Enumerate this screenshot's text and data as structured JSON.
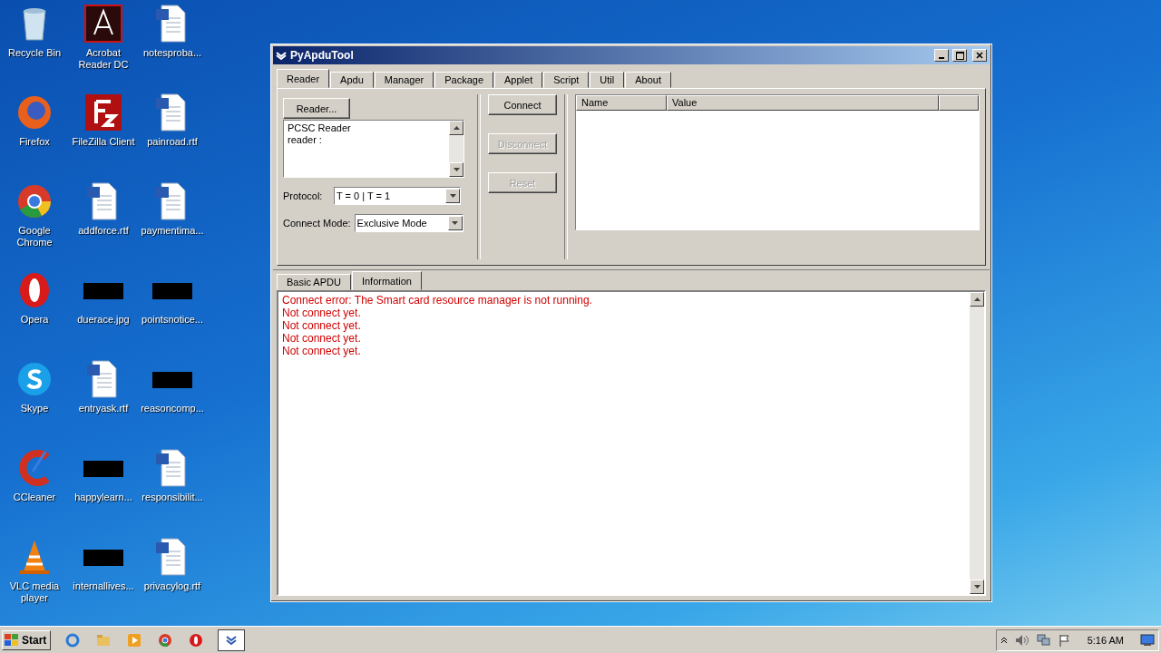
{
  "desktop_icons": [
    {
      "label": "Recycle Bin",
      "kind": "recycle"
    },
    {
      "label": "Acrobat\nReader DC",
      "kind": "pdf"
    },
    {
      "label": "notesproba...",
      "kind": "word"
    },
    {
      "label": "Firefox",
      "kind": "firefox"
    },
    {
      "label": "FileZilla Client",
      "kind": "filezilla"
    },
    {
      "label": "painroad.rtf",
      "kind": "word"
    },
    {
      "label": "Google\nChrome",
      "kind": "chrome"
    },
    {
      "label": "addforce.rtf",
      "kind": "word"
    },
    {
      "label": "paymentima...",
      "kind": "word"
    },
    {
      "label": "Opera",
      "kind": "opera"
    },
    {
      "label": "duerace.jpg",
      "kind": "black"
    },
    {
      "label": "pointsnotice...",
      "kind": "black"
    },
    {
      "label": "Skype",
      "kind": "skype"
    },
    {
      "label": "entryask.rtf",
      "kind": "word"
    },
    {
      "label": "reasoncomp...",
      "kind": "black"
    },
    {
      "label": "CCleaner",
      "kind": "ccleaner"
    },
    {
      "label": "happylearn...",
      "kind": "black"
    },
    {
      "label": "responsibilit...",
      "kind": "word"
    },
    {
      "label": "VLC media\nplayer",
      "kind": "vlc"
    },
    {
      "label": "internallives...",
      "kind": "black"
    },
    {
      "label": "privacylog.rtf",
      "kind": "word"
    }
  ],
  "window": {
    "title": "PyApduTool",
    "tabs": [
      {
        "label": "Reader",
        "selected": true
      },
      {
        "label": "Apdu",
        "selected": false
      },
      {
        "label": "Manager",
        "selected": false
      },
      {
        "label": "Package",
        "selected": false
      },
      {
        "label": "Applet",
        "selected": false
      },
      {
        "label": "Script",
        "selected": false
      },
      {
        "label": "Util",
        "selected": false
      },
      {
        "label": "About",
        "selected": false
      }
    ],
    "reader_button": "Reader...",
    "reader_list": [
      "PCSC Reader",
      "reader :"
    ],
    "protocol": {
      "label": "Protocol:",
      "value": "T = 0 | T = 1"
    },
    "connect_mode": {
      "label": "Connect Mode:",
      "value": "Exclusive Mode"
    },
    "actions": [
      {
        "label": "Connect",
        "disabled": false
      },
      {
        "label": "Disconnect",
        "disabled": true
      },
      {
        "label": "Reset",
        "disabled": true
      }
    ],
    "table": {
      "columns": [
        "Name",
        "Value"
      ]
    },
    "bottom_tabs": [
      {
        "label": "Basic APDU",
        "selected": false
      },
      {
        "label": "Information",
        "selected": true
      }
    ],
    "log": [
      "Connect error: The Smart card resource manager is not running.",
      "Not connect yet.",
      "Not connect yet.",
      "Not connect yet.",
      "Not connect yet."
    ]
  },
  "taskbar": {
    "start": "Start",
    "apps": [
      {
        "kind": "ie",
        "active": false
      },
      {
        "kind": "explorer",
        "active": false
      },
      {
        "kind": "media",
        "active": false
      },
      {
        "kind": "chrome",
        "active": false
      },
      {
        "kind": "opera",
        "active": false
      },
      {
        "kind": "pyapdu",
        "active": true
      }
    ],
    "clock": "5:16 AM"
  }
}
